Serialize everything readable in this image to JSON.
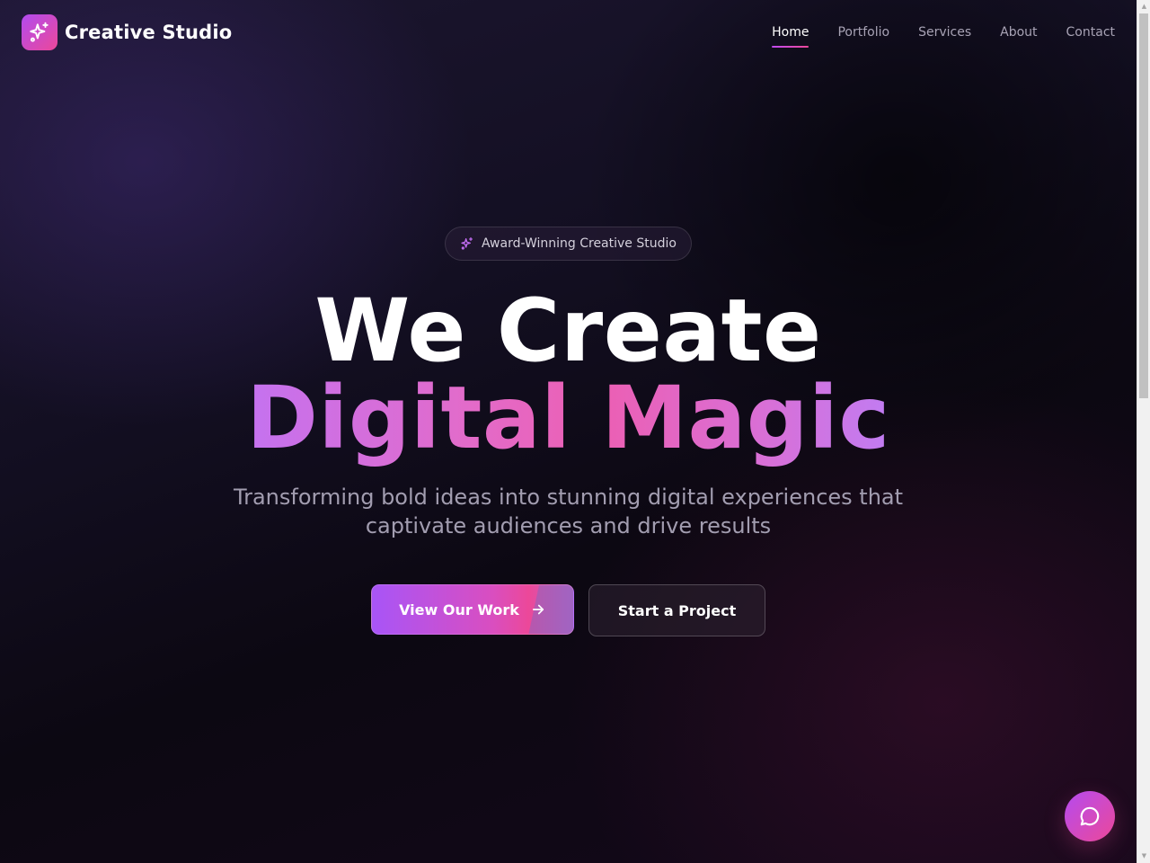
{
  "header": {
    "brand_name": "Creative Studio",
    "nav": [
      {
        "label": "Home",
        "active": true
      },
      {
        "label": "Portfolio",
        "active": false
      },
      {
        "label": "Services",
        "active": false
      },
      {
        "label": "About",
        "active": false
      },
      {
        "label": "Contact",
        "active": false
      }
    ]
  },
  "hero": {
    "badge": "Award-Winning Creative Studio",
    "headline_line1": "We Create",
    "headline_line2": "Digital Magic",
    "subtitle": "Transforming bold ideas into stunning digital experiences that captivate audiences and drive results",
    "primary_button": "View Our Work",
    "secondary_button": "Start a Project"
  },
  "icons": {
    "logo": "sparkles-icon",
    "badge": "sparkles-icon",
    "primary_button": "arrow-right-icon",
    "chat": "chat-bubble-icon"
  },
  "colors": {
    "accent_purple": "#a855f7",
    "accent_pink": "#ec4899",
    "background": "#130f22",
    "text_muted": "#a29db0"
  }
}
